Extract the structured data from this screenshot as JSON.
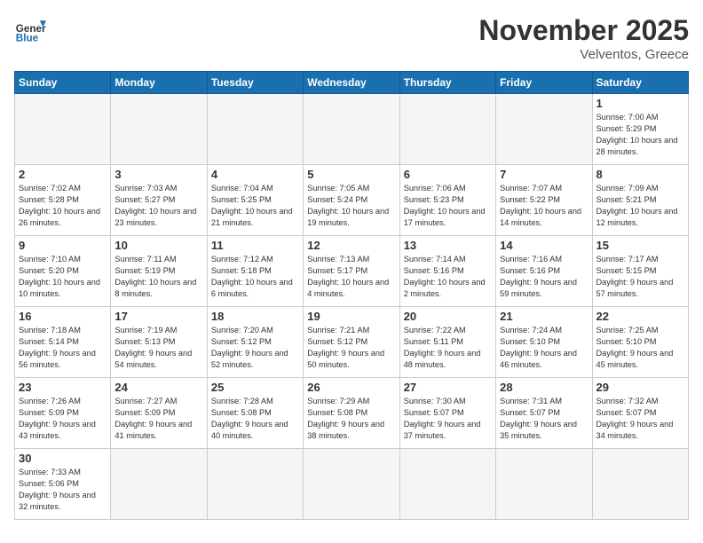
{
  "header": {
    "logo_general": "General",
    "logo_blue": "Blue",
    "month_title": "November 2025",
    "location": "Velventos, Greece"
  },
  "weekdays": [
    "Sunday",
    "Monday",
    "Tuesday",
    "Wednesday",
    "Thursday",
    "Friday",
    "Saturday"
  ],
  "days": [
    {
      "num": "",
      "empty": true
    },
    {
      "num": "",
      "empty": true
    },
    {
      "num": "",
      "empty": true
    },
    {
      "num": "",
      "empty": true
    },
    {
      "num": "",
      "empty": true
    },
    {
      "num": "",
      "empty": true
    },
    {
      "num": "1",
      "sunrise": "7:00 AM",
      "sunset": "5:29 PM",
      "daylight": "10 hours and 28 minutes."
    },
    {
      "num": "2",
      "sunrise": "7:02 AM",
      "sunset": "5:28 PM",
      "daylight": "10 hours and 26 minutes."
    },
    {
      "num": "3",
      "sunrise": "7:03 AM",
      "sunset": "5:27 PM",
      "daylight": "10 hours and 23 minutes."
    },
    {
      "num": "4",
      "sunrise": "7:04 AM",
      "sunset": "5:25 PM",
      "daylight": "10 hours and 21 minutes."
    },
    {
      "num": "5",
      "sunrise": "7:05 AM",
      "sunset": "5:24 PM",
      "daylight": "10 hours and 19 minutes."
    },
    {
      "num": "6",
      "sunrise": "7:06 AM",
      "sunset": "5:23 PM",
      "daylight": "10 hours and 17 minutes."
    },
    {
      "num": "7",
      "sunrise": "7:07 AM",
      "sunset": "5:22 PM",
      "daylight": "10 hours and 14 minutes."
    },
    {
      "num": "8",
      "sunrise": "7:09 AM",
      "sunset": "5:21 PM",
      "daylight": "10 hours and 12 minutes."
    },
    {
      "num": "9",
      "sunrise": "7:10 AM",
      "sunset": "5:20 PM",
      "daylight": "10 hours and 10 minutes."
    },
    {
      "num": "10",
      "sunrise": "7:11 AM",
      "sunset": "5:19 PM",
      "daylight": "10 hours and 8 minutes."
    },
    {
      "num": "11",
      "sunrise": "7:12 AM",
      "sunset": "5:18 PM",
      "daylight": "10 hours and 6 minutes."
    },
    {
      "num": "12",
      "sunrise": "7:13 AM",
      "sunset": "5:17 PM",
      "daylight": "10 hours and 4 minutes."
    },
    {
      "num": "13",
      "sunrise": "7:14 AM",
      "sunset": "5:16 PM",
      "daylight": "10 hours and 2 minutes."
    },
    {
      "num": "14",
      "sunrise": "7:16 AM",
      "sunset": "5:16 PM",
      "daylight": "9 hours and 59 minutes."
    },
    {
      "num": "15",
      "sunrise": "7:17 AM",
      "sunset": "5:15 PM",
      "daylight": "9 hours and 57 minutes."
    },
    {
      "num": "16",
      "sunrise": "7:18 AM",
      "sunset": "5:14 PM",
      "daylight": "9 hours and 56 minutes."
    },
    {
      "num": "17",
      "sunrise": "7:19 AM",
      "sunset": "5:13 PM",
      "daylight": "9 hours and 54 minutes."
    },
    {
      "num": "18",
      "sunrise": "7:20 AM",
      "sunset": "5:12 PM",
      "daylight": "9 hours and 52 minutes."
    },
    {
      "num": "19",
      "sunrise": "7:21 AM",
      "sunset": "5:12 PM",
      "daylight": "9 hours and 50 minutes."
    },
    {
      "num": "20",
      "sunrise": "7:22 AM",
      "sunset": "5:11 PM",
      "daylight": "9 hours and 48 minutes."
    },
    {
      "num": "21",
      "sunrise": "7:24 AM",
      "sunset": "5:10 PM",
      "daylight": "9 hours and 46 minutes."
    },
    {
      "num": "22",
      "sunrise": "7:25 AM",
      "sunset": "5:10 PM",
      "daylight": "9 hours and 45 minutes."
    },
    {
      "num": "23",
      "sunrise": "7:26 AM",
      "sunset": "5:09 PM",
      "daylight": "9 hours and 43 minutes."
    },
    {
      "num": "24",
      "sunrise": "7:27 AM",
      "sunset": "5:09 PM",
      "daylight": "9 hours and 41 minutes."
    },
    {
      "num": "25",
      "sunrise": "7:28 AM",
      "sunset": "5:08 PM",
      "daylight": "9 hours and 40 minutes."
    },
    {
      "num": "26",
      "sunrise": "7:29 AM",
      "sunset": "5:08 PM",
      "daylight": "9 hours and 38 minutes."
    },
    {
      "num": "27",
      "sunrise": "7:30 AM",
      "sunset": "5:07 PM",
      "daylight": "9 hours and 37 minutes."
    },
    {
      "num": "28",
      "sunrise": "7:31 AM",
      "sunset": "5:07 PM",
      "daylight": "9 hours and 35 minutes."
    },
    {
      "num": "29",
      "sunrise": "7:32 AM",
      "sunset": "5:07 PM",
      "daylight": "9 hours and 34 minutes."
    },
    {
      "num": "30",
      "sunrise": "7:33 AM",
      "sunset": "5:06 PM",
      "daylight": "9 hours and 32 minutes."
    }
  ]
}
